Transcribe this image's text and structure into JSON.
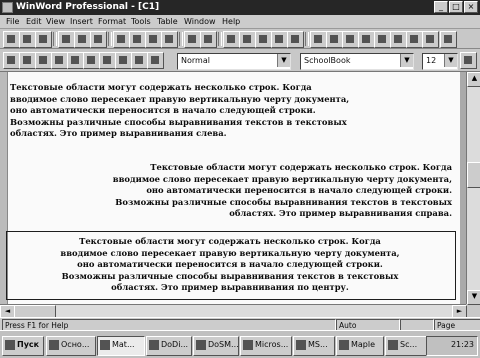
{
  "window": {
    "title": "WinWord Professional - [C1]",
    "buttons": [
      "_",
      "□",
      "×"
    ]
  },
  "menu": [
    "File",
    "Edit",
    "View",
    "Insert",
    "Format",
    "Tools",
    "Table",
    "Window",
    "Help"
  ],
  "format_bar": {
    "style": "Normal",
    "font": "SchoolBook",
    "size": "12"
  },
  "document": {
    "paragraphs": [
      {
        "align": "left",
        "text": "    Текстовые области могут содержать несколько строк. Когда\nвводимое слово пересекает правую вертикальную черту документа,\nоно автоматически переносится в начало следующей строки.\nВозможны различные способы выравнивания текстов в текстовых\nобластях. Это пример выравнивания слева."
      },
      {
        "align": "right",
        "text": "Текстовые области могут содержать несколько строк. Когда\nвводимое слово пересекает правую вертикальную черту документа,\nоно автоматически переносится в начало следующей строки.\nВозможны различные способы выравнивания текстов в текстовых\nобластях. Это пример выравнивания справа."
      },
      {
        "align": "center",
        "text": "Текстовые области могут содержать несколько строк. Когда\nвводимое слово пересекает правую вертикальную черту документа,\nоно автоматически переносится в начало следующей строки.\nВозможны различные способы выравнивания текстов в текстовых\nобластях. Это пример выравнивания по центру."
      }
    ]
  },
  "status": {
    "help": "Press F1 for Help",
    "mode": "Auto",
    "page": "Page"
  },
  "taskbar": {
    "items": [
      "Пуск",
      "Осно...",
      "Mat...",
      "DoDi...",
      "DoSM...",
      "Micros...",
      "MS...",
      "Maple",
      "Sc..."
    ],
    "active_index": 2,
    "clock": "21:23"
  }
}
